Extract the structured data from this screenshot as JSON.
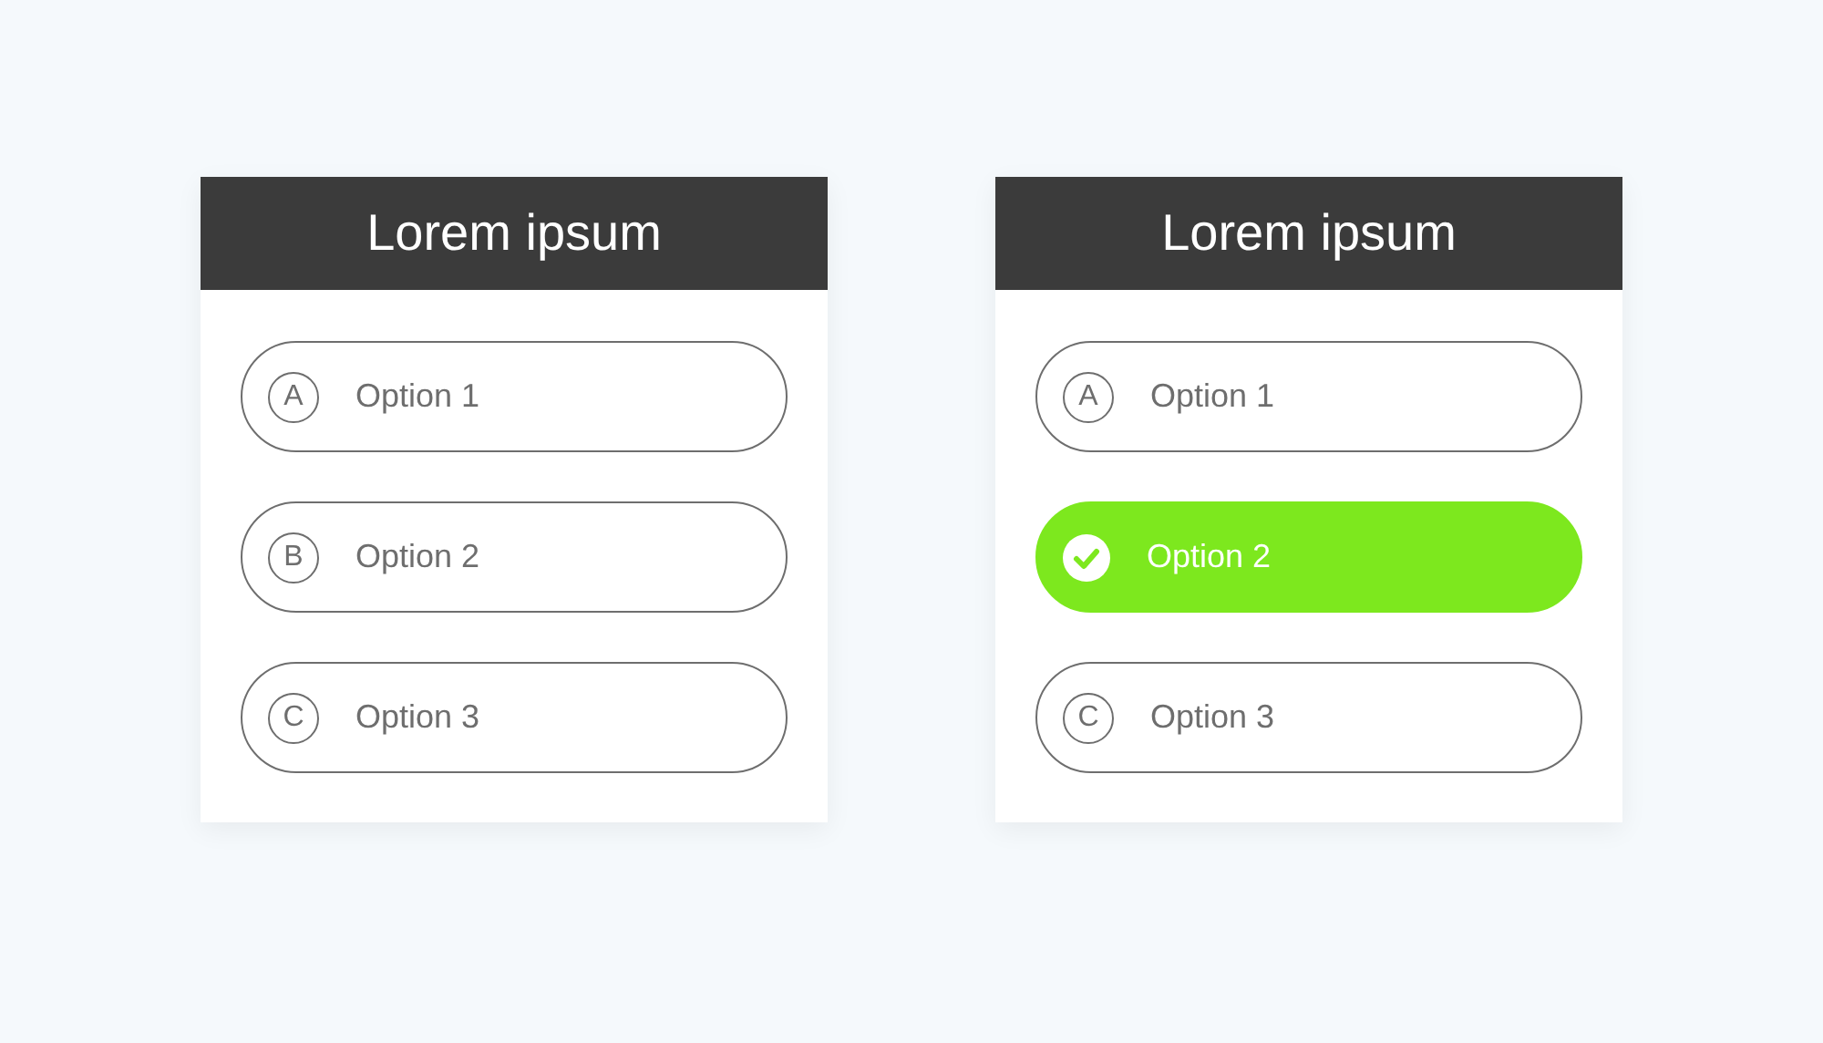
{
  "cards": [
    {
      "title": "Lorem ipsum",
      "options": [
        {
          "marker": "A",
          "label": "Option 1",
          "selected": false
        },
        {
          "marker": "B",
          "label": "Option 2",
          "selected": false
        },
        {
          "marker": "C",
          "label": "Option 3",
          "selected": false
        }
      ]
    },
    {
      "title": "Lorem ipsum",
      "options": [
        {
          "marker": "A",
          "label": "Option 1",
          "selected": false
        },
        {
          "label": "Option 2",
          "selected": true
        },
        {
          "marker": "C",
          "label": "Option 3",
          "selected": false
        }
      ]
    }
  ]
}
